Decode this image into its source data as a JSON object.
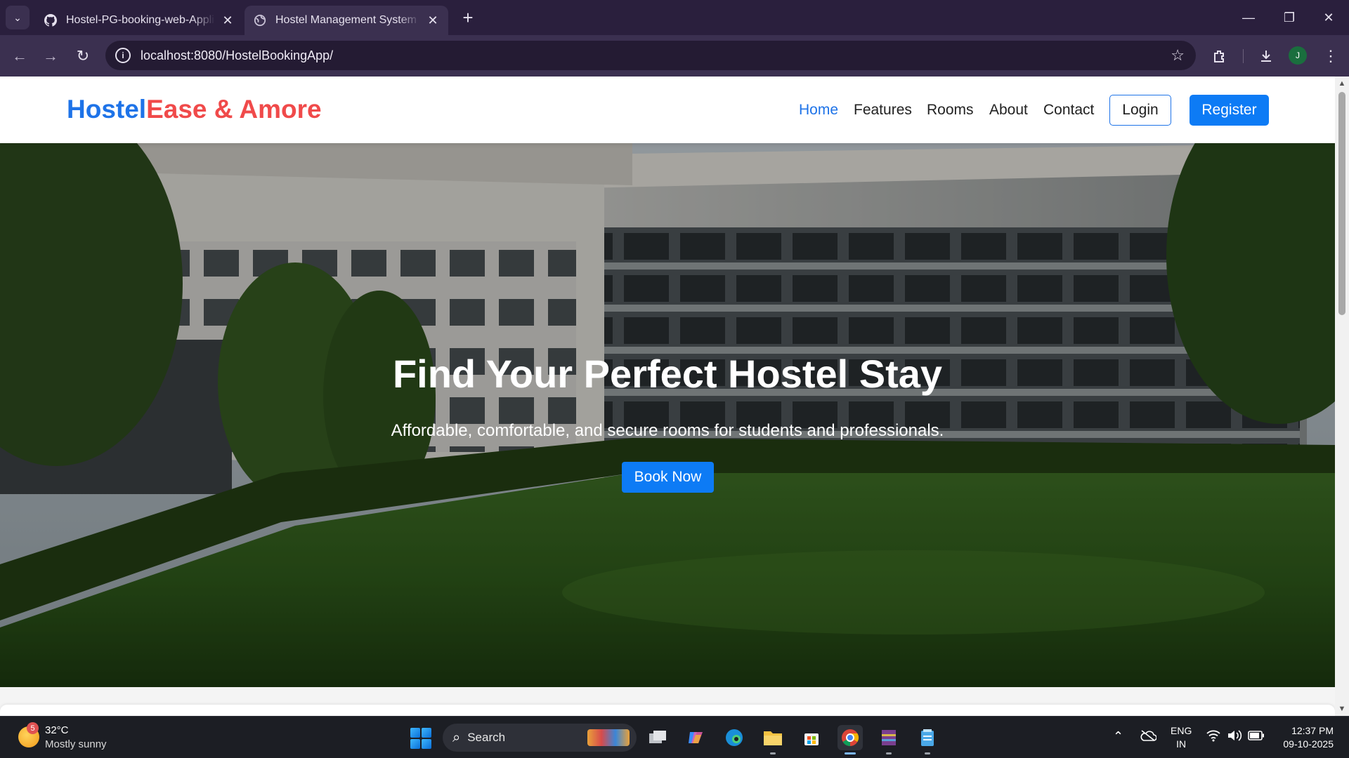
{
  "browser": {
    "tabs": [
      {
        "title": "Hostel-PG-booking-web-Applic",
        "icon": "github-icon",
        "active": false
      },
      {
        "title": "Hostel Management System | H",
        "icon": "globe-icon",
        "active": true
      }
    ],
    "url": "localhost:8080/HostelBookingApp/",
    "profile_initial": "J"
  },
  "site": {
    "brand_part1": "Hostel",
    "brand_part2": "Ease & Amore",
    "nav": [
      "Home",
      "Features",
      "Rooms",
      "About",
      "Contact"
    ],
    "active_nav": "Home",
    "login_label": "Login",
    "register_label": "Register",
    "hero": {
      "title": "Find Your Perfect Hostel Stay",
      "subtitle": "Affordable, comfortable, and secure rooms for students and professionals.",
      "cta_label": "Book Now"
    },
    "colors": {
      "brand_blue": "#1e73e8",
      "brand_red": "#f04a4a",
      "button_blue": "#0d7bf5"
    }
  },
  "taskbar": {
    "weather": {
      "temp": "32°C",
      "desc": "Mostly sunny",
      "badge": "5"
    },
    "search_label": "Search",
    "apps": [
      "task-view-icon",
      "copilot-icon",
      "edge-icon",
      "file-explorer-icon",
      "store-icon",
      "chrome-icon",
      "winrar-icon",
      "notepad-icon"
    ],
    "lang_line1": "ENG",
    "lang_line2": "IN",
    "time": "12:37 PM",
    "date": "09-10-2025"
  }
}
